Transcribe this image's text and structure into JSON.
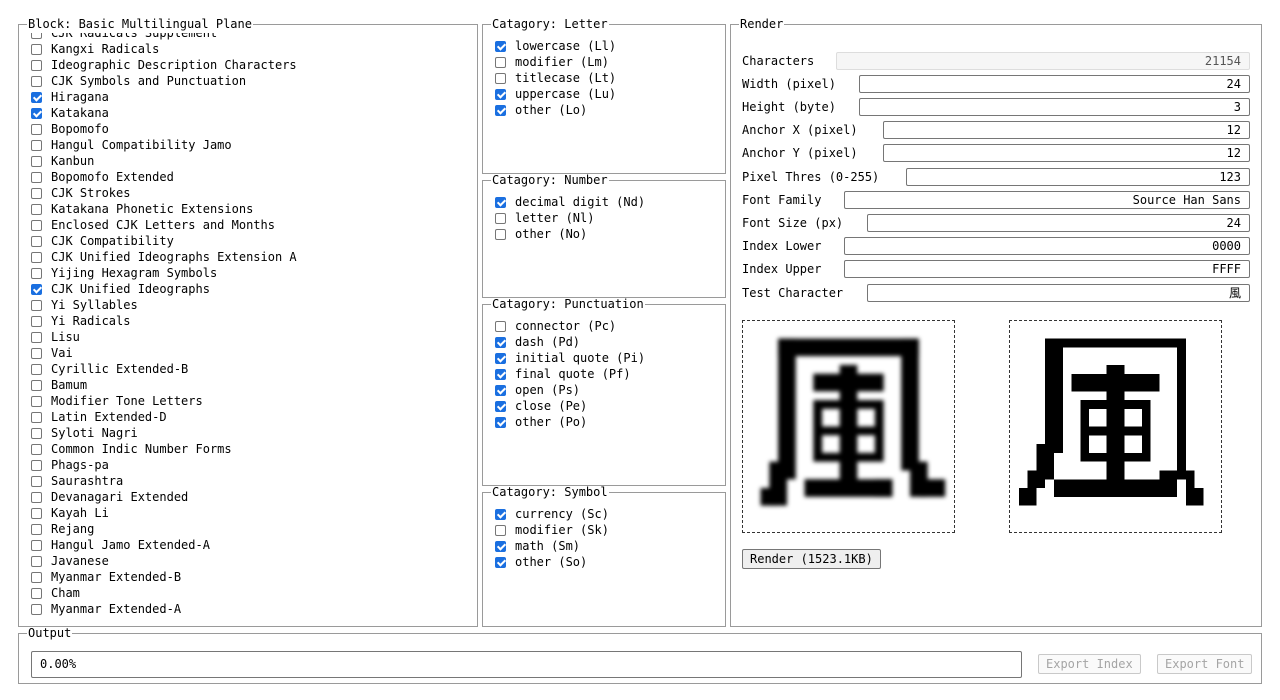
{
  "block": {
    "legend": "Block: Basic Multilingual Plane",
    "items": [
      {
        "label": "CJK Radicals Supplement",
        "checked": false
      },
      {
        "label": "Kangxi Radicals",
        "checked": false
      },
      {
        "label": "Ideographic Description Characters",
        "checked": false
      },
      {
        "label": "CJK Symbols and Punctuation",
        "checked": false
      },
      {
        "label": "Hiragana",
        "checked": true
      },
      {
        "label": "Katakana",
        "checked": true
      },
      {
        "label": "Bopomofo",
        "checked": false
      },
      {
        "label": "Hangul Compatibility Jamo",
        "checked": false
      },
      {
        "label": "Kanbun",
        "checked": false
      },
      {
        "label": "Bopomofo Extended",
        "checked": false
      },
      {
        "label": "CJK Strokes",
        "checked": false
      },
      {
        "label": "Katakana Phonetic Extensions",
        "checked": false
      },
      {
        "label": "Enclosed CJK Letters and Months",
        "checked": false
      },
      {
        "label": "CJK Compatibility",
        "checked": false
      },
      {
        "label": "CJK Unified Ideographs Extension A",
        "checked": false
      },
      {
        "label": "Yijing Hexagram Symbols",
        "checked": false
      },
      {
        "label": "CJK Unified Ideographs",
        "checked": true
      },
      {
        "label": "Yi Syllables",
        "checked": false
      },
      {
        "label": "Yi Radicals",
        "checked": false
      },
      {
        "label": "Lisu",
        "checked": false
      },
      {
        "label": "Vai",
        "checked": false
      },
      {
        "label": "Cyrillic Extended-B",
        "checked": false
      },
      {
        "label": "Bamum",
        "checked": false
      },
      {
        "label": "Modifier Tone Letters",
        "checked": false
      },
      {
        "label": "Latin Extended-D",
        "checked": false
      },
      {
        "label": "Syloti Nagri",
        "checked": false
      },
      {
        "label": "Common Indic Number Forms",
        "checked": false
      },
      {
        "label": "Phags-pa",
        "checked": false
      },
      {
        "label": "Saurashtra",
        "checked": false
      },
      {
        "label": "Devanagari Extended",
        "checked": false
      },
      {
        "label": "Kayah Li",
        "checked": false
      },
      {
        "label": "Rejang",
        "checked": false
      },
      {
        "label": "Hangul Jamo Extended-A",
        "checked": false
      },
      {
        "label": "Javanese",
        "checked": false
      },
      {
        "label": "Myanmar Extended-B",
        "checked": false
      },
      {
        "label": "Cham",
        "checked": false
      },
      {
        "label": "Myanmar Extended-A",
        "checked": false
      }
    ]
  },
  "categories": [
    {
      "key": "letter",
      "legend": "Catagory: Letter",
      "items": [
        {
          "label": "lowercase (Ll)",
          "checked": true
        },
        {
          "label": "modifier (Lm)",
          "checked": false
        },
        {
          "label": "titlecase (Lt)",
          "checked": false
        },
        {
          "label": "uppercase (Lu)",
          "checked": true
        },
        {
          "label": "other (Lo)",
          "checked": true
        }
      ]
    },
    {
      "key": "number",
      "legend": "Catagory: Number",
      "items": [
        {
          "label": "decimal digit (Nd)",
          "checked": true
        },
        {
          "label": "letter (Nl)",
          "checked": false
        },
        {
          "label": "other (No)",
          "checked": false
        }
      ]
    },
    {
      "key": "punctuation",
      "legend": "Catagory: Punctuation",
      "items": [
        {
          "label": "connector (Pc)",
          "checked": false
        },
        {
          "label": "dash (Pd)",
          "checked": true
        },
        {
          "label": "initial quote (Pi)",
          "checked": true
        },
        {
          "label": "final quote (Pf)",
          "checked": true
        },
        {
          "label": "open (Ps)",
          "checked": true
        },
        {
          "label": "close (Pe)",
          "checked": true
        },
        {
          "label": "other (Po)",
          "checked": true
        }
      ]
    },
    {
      "key": "symbol",
      "legend": "Catagory: Symbol",
      "items": [
        {
          "label": "currency (Sc)",
          "checked": true
        },
        {
          "label": "modifier (Sk)",
          "checked": false
        },
        {
          "label": "math (Sm)",
          "checked": true
        },
        {
          "label": "other (So)",
          "checked": true
        }
      ]
    }
  ],
  "render": {
    "legend": "Render",
    "fields": {
      "characters": {
        "label": "Characters",
        "value": "21154"
      },
      "width": {
        "label": "Width (pixel)",
        "value": "24"
      },
      "height": {
        "label": "Height (byte)",
        "value": "3"
      },
      "anchor_x": {
        "label": "Anchor X (pixel)",
        "value": "12"
      },
      "anchor_y": {
        "label": "Anchor Y (pixel)",
        "value": "12"
      },
      "pixel_thres": {
        "label": "Pixel Thres (0-255)",
        "value": "123"
      },
      "font_family": {
        "label": "Font Family",
        "value": "Source Han Sans"
      },
      "font_size": {
        "label": "Font Size (px)",
        "value": "24"
      },
      "index_lower": {
        "label": "Index Lower",
        "value": "0000"
      },
      "index_upper": {
        "label": "Index Upper",
        "value": "FFFF"
      },
      "test_char": {
        "label": "Test Character",
        "value": "風"
      }
    },
    "render_button": "Render (1523.1KB)"
  },
  "output": {
    "legend": "Output",
    "value": "0.00%",
    "export_index": "Export Index",
    "export_font": "Export Font"
  },
  "colors": {
    "checkbox_accent": "#1a6fe0",
    "border": "#9a9a9a"
  }
}
